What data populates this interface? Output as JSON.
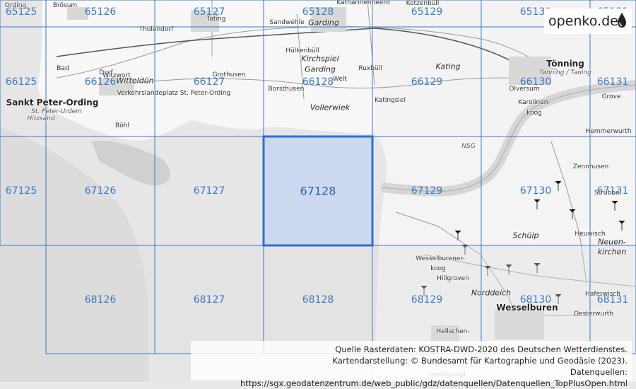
{
  "brand": {
    "name": "openko.de",
    "icon": "water-drop-icon"
  },
  "grid": {
    "cells": [
      {
        "id": "65125",
        "col": 0,
        "row": 0
      },
      {
        "id": "65126",
        "col": 1,
        "row": 0
      },
      {
        "id": "65127",
        "col": 2,
        "row": 0
      },
      {
        "id": "65128",
        "col": 3,
        "row": 0
      },
      {
        "id": "65129",
        "col": 4,
        "row": 0
      },
      {
        "id": "65130",
        "col": 5,
        "row": 0
      },
      {
        "id": "65131",
        "col": 6,
        "row": 0
      },
      {
        "id": "66125",
        "col": 0,
        "row": 1
      },
      {
        "id": "66126",
        "col": 1,
        "row": 1
      },
      {
        "id": "66127",
        "col": 2,
        "row": 1
      },
      {
        "id": "66128",
        "col": 3,
        "row": 1
      },
      {
        "id": "66129",
        "col": 4,
        "row": 1
      },
      {
        "id": "66130",
        "col": 5,
        "row": 1
      },
      {
        "id": "66131",
        "col": 6,
        "row": 1
      },
      {
        "id": "67125",
        "col": 0,
        "row": 2
      },
      {
        "id": "67126",
        "col": 1,
        "row": 2
      },
      {
        "id": "67127",
        "col": 2,
        "row": 2
      },
      {
        "id": "67128",
        "col": 3,
        "row": 2,
        "selected": true
      },
      {
        "id": "67129",
        "col": 4,
        "row": 2
      },
      {
        "id": "67130",
        "col": 5,
        "row": 2
      },
      {
        "id": "67131",
        "col": 6,
        "row": 2
      },
      {
        "id": "68126",
        "col": 1,
        "row": 3
      },
      {
        "id": "68127",
        "col": 2,
        "row": 3
      },
      {
        "id": "68128",
        "col": 3,
        "row": 3
      },
      {
        "id": "68129",
        "col": 4,
        "row": 3
      },
      {
        "id": "68130",
        "col": 5,
        "row": 3
      },
      {
        "id": "68131",
        "col": 6,
        "row": 3
      }
    ],
    "line_color": "#3a79c4",
    "selected_fill": "#c6d5ee",
    "selected_stroke": "#2f6fd6"
  },
  "places": [
    {
      "name": "Ording",
      "size": "small"
    },
    {
      "name": "Brösum",
      "size": "small"
    },
    {
      "name": "Tating",
      "size": "small"
    },
    {
      "name": "Sandwehle",
      "size": "small"
    },
    {
      "name": "Garding",
      "size": "medium"
    },
    {
      "name": "Katharinenheerd",
      "size": "small"
    },
    {
      "name": "Kotzenbüll",
      "size": "small"
    },
    {
      "name": "Tholendorf",
      "size": "small"
    },
    {
      "name": "Bad",
      "size": "small"
    },
    {
      "name": "Dorf",
      "size": "small"
    },
    {
      "name": "Witzwort",
      "size": "small"
    },
    {
      "name": "Witteldün",
      "size": "medium"
    },
    {
      "name": "Hülkenbüll",
      "size": "small"
    },
    {
      "name": "Kirchspiel",
      "size": "medium"
    },
    {
      "name": "Garding",
      "size": "medium"
    },
    {
      "name": "Ruxbüll",
      "size": "small"
    },
    {
      "name": "Kating",
      "size": "medium"
    },
    {
      "name": "Tönning",
      "size": "large"
    },
    {
      "name": "Tønning / Taning",
      "size": "sub"
    },
    {
      "name": "Grothusen",
      "size": "small"
    },
    {
      "name": "Welt",
      "size": "small"
    },
    {
      "name": "Verkehrslandeplatz St. Peter-Ording",
      "size": "small"
    },
    {
      "name": "Borsthusen",
      "size": "small"
    },
    {
      "name": "Olversum",
      "size": "small"
    },
    {
      "name": "Sankt Peter-Ording",
      "size": "large"
    },
    {
      "name": "St. Peter-Urdem",
      "size": "sub"
    },
    {
      "name": "Hitzsand",
      "size": "sub"
    },
    {
      "name": "Vollerwiek",
      "size": "medium"
    },
    {
      "name": "Katingsiel",
      "size": "small"
    },
    {
      "name": "Karolinen-",
      "size": "small"
    },
    {
      "name": "koog",
      "size": "small"
    },
    {
      "name": "Grove",
      "size": "small"
    },
    {
      "name": "Böhl",
      "size": "small"
    },
    {
      "name": "Hemmerwurth",
      "size": "small"
    },
    {
      "name": "Zennhusen",
      "size": "small"
    },
    {
      "name": "Strübbel",
      "size": "small"
    },
    {
      "name": "Schülp",
      "size": "medium"
    },
    {
      "name": "Heuwisch",
      "size": "small"
    },
    {
      "name": "Neuen-",
      "size": "medium"
    },
    {
      "name": "kirchen",
      "size": "medium"
    },
    {
      "name": "Wesselburener-",
      "size": "small"
    },
    {
      "name": "koog",
      "size": "small"
    },
    {
      "name": "Hillgroven",
      "size": "small"
    },
    {
      "name": "Norddeich",
      "size": "medium"
    },
    {
      "name": "Haferwisch",
      "size": "small"
    },
    {
      "name": "Wesselburen",
      "size": "large"
    },
    {
      "name": "Oesterwurth",
      "size": "small"
    },
    {
      "name": "Hellschen-",
      "size": "small"
    },
    {
      "name": "Heringsand",
      "size": "small"
    },
    {
      "name": "NSG",
      "size": "sub"
    }
  ],
  "attribution": {
    "line1": "Quelle Rasterdaten: KOSTRA-DWD-2020 des Deutschen Wetterdienstes.",
    "line2": "Kartendarstellung: © Bundesamt für Kartographie und Geodäsie (2023).",
    "line3": "Datenquellen: https://sgx.geodatenzentrum.de/web_public/gdz/datenquellen/Datenquellen_TopPlusOpen.html"
  }
}
